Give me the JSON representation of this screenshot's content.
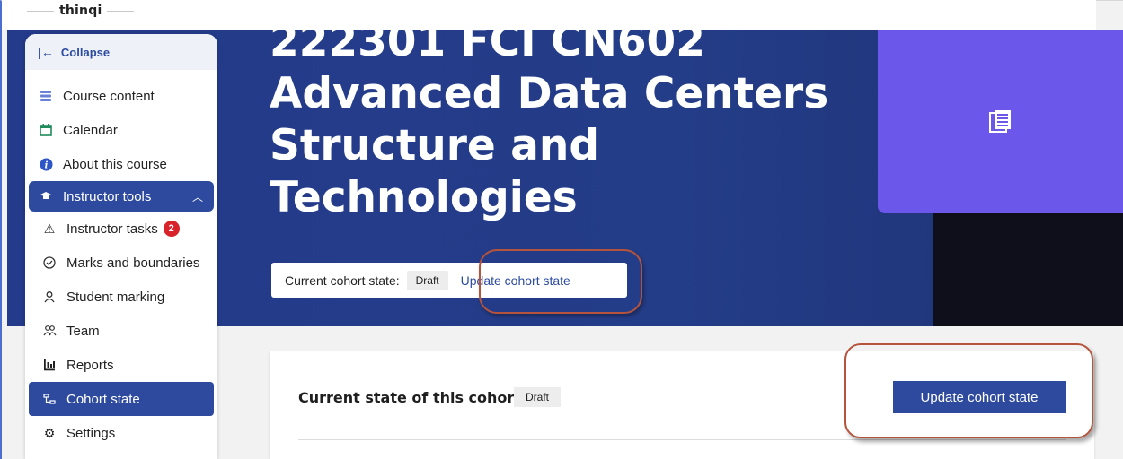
{
  "topbar": {
    "logo_text": "thinqi"
  },
  "sidebar": {
    "collapse_label": "Collapse",
    "items": [
      {
        "label": "Course content",
        "icon": "stack-icon"
      },
      {
        "label": "Calendar",
        "icon": "calendar-icon"
      },
      {
        "label": "About this course",
        "icon": "info-icon"
      }
    ],
    "instructor_tools": {
      "label": "Instructor tools",
      "sub_items": [
        {
          "label": "Instructor tasks",
          "badge": "2"
        },
        {
          "label": "Marks and boundaries"
        },
        {
          "label": "Student marking"
        },
        {
          "label": "Team"
        },
        {
          "label": "Reports"
        },
        {
          "label": "Cohort state"
        },
        {
          "label": "Settings"
        }
      ]
    }
  },
  "hero": {
    "title": "222301 FCI CN602 Advanced Data Centers Structure and Technologies",
    "cohort_label": "Current cohort state:",
    "cohort_state": "Draft",
    "update_link": "Update cohort state"
  },
  "content": {
    "state_label": "Current state of this cohort:",
    "state_value": "Draft",
    "update_button": "Update cohort state"
  },
  "colors": {
    "primary": "#2e4a9e",
    "hero_bg": "#243a8a",
    "tile": "#6b57ea",
    "badge_red": "#d8232a",
    "annotation": "#b5533c"
  }
}
